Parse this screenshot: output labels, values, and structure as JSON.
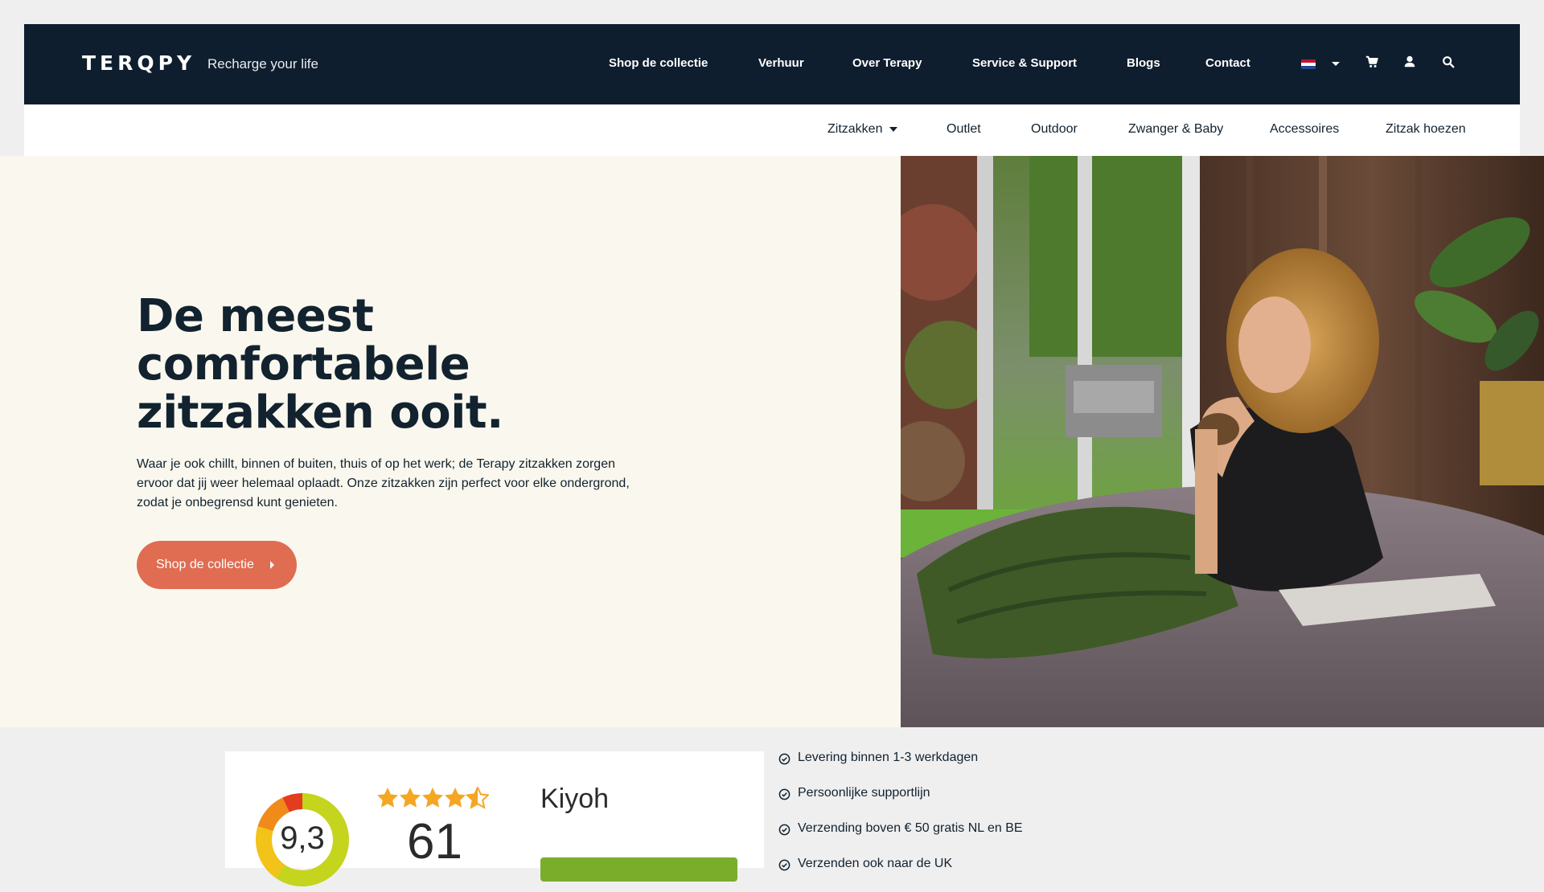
{
  "brand": {
    "logo_text": "TERQPY",
    "tagline": "Recharge your life"
  },
  "main_nav": [
    {
      "label": "Shop de collectie"
    },
    {
      "label": "Verhuur"
    },
    {
      "label": "Over Terapy"
    },
    {
      "label": "Service & Support"
    },
    {
      "label": "Blogs"
    },
    {
      "label": "Contact"
    }
  ],
  "utility_icons": [
    "language-flag-nl",
    "cart-icon",
    "account-icon",
    "search-icon"
  ],
  "sub_nav": [
    {
      "label": "Zitzakken",
      "has_dropdown": true
    },
    {
      "label": "Outlet"
    },
    {
      "label": "Outdoor"
    },
    {
      "label": "Zwanger & Baby"
    },
    {
      "label": "Accessoires"
    },
    {
      "label": "Zitzak hoezen"
    }
  ],
  "hero": {
    "title": "De meest comfortabele zitzakken ooit.",
    "text": "Waar je ook chillt, binnen of buiten, thuis of op het werk; de Terapy zitzakken zorgen ervoor dat jij weer helemaal oplaadt. Onze zitzakken zijn perfect voor elke ondergrond, zodat je onbegrensd kunt genieten.",
    "cta_label": "Shop de collectie"
  },
  "reviews": {
    "score": "9,3",
    "stars": 4.5,
    "count": "61",
    "provider": "Kiyoh"
  },
  "usps": [
    "Levering binnen 1-3 werkdagen",
    "Persoonlijke supportlijn",
    "Verzending boven € 50 gratis NL en BE",
    "Verzenden ook naar de UK"
  ],
  "colors": {
    "navy": "#0f1e2e",
    "cream": "#faf8ee",
    "accent": "#e06c52",
    "star": "#f5a623",
    "review_green": "#7aad2a"
  }
}
